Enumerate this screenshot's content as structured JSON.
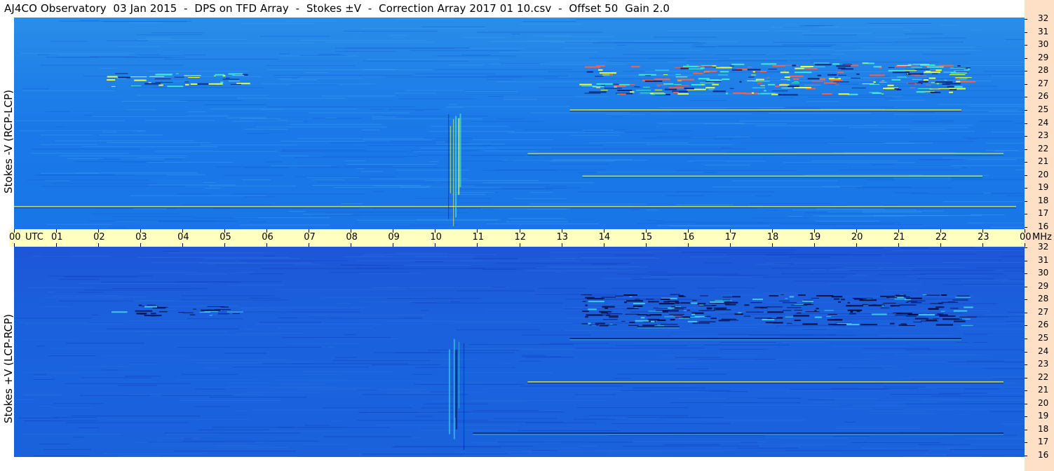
{
  "title": "AJ4CO Observatory  03 Jan 2015  -  DPS on TFD Array  -  Stokes ±V  -  Correction Array 2017 01 10.csv  -  Offset 50  Gain 2.0",
  "colors": {
    "background_top": "#1f80e8",
    "background_bottom": "#1a5fdc",
    "time_bar": "#ffffc0",
    "freq_strip": "#fde0c6",
    "signal_high": "#e8ff40",
    "signal_low": "#0a1a60"
  },
  "chart_data": [
    {
      "type": "heatmap",
      "panel": "top",
      "ylabel": "Stokes -V (RCP-LCP)",
      "x_unit": "UTC",
      "x_ticks": [
        "00",
        "01",
        "02",
        "03",
        "04",
        "05",
        "06",
        "07",
        "08",
        "09",
        "10",
        "11",
        "12",
        "13",
        "14",
        "15",
        "16",
        "17",
        "18",
        "19",
        "20",
        "21",
        "22",
        "23",
        "00"
      ],
      "y_unit": "MHz",
      "y_ticks": [
        "32",
        "31",
        "30",
        "29",
        "28",
        "27",
        "26",
        "25",
        "24",
        "23",
        "22",
        "21",
        "20",
        "19",
        "18",
        "17",
        "16"
      ],
      "xlim": [
        0,
        24
      ],
      "ylim": [
        16,
        32
      ],
      "features": [
        {
          "kind": "band",
          "x": [
            2.2,
            5.3
          ],
          "y": [
            26.8,
            27.8
          ],
          "intensity": "mixed"
        },
        {
          "kind": "band",
          "x": [
            13.4,
            22.6
          ],
          "y": [
            26.2,
            28.6
          ],
          "intensity": "high"
        },
        {
          "kind": "line",
          "x": [
            0.0,
            23.8
          ],
          "y": [
            17.7,
            17.7
          ],
          "intensity": "high"
        },
        {
          "kind": "line",
          "x": [
            12.2,
            23.5
          ],
          "y": [
            21.7,
            21.7
          ],
          "intensity": "high"
        },
        {
          "kind": "line",
          "x": [
            13.5,
            23.0
          ],
          "y": [
            20.0,
            20.0
          ],
          "intensity": "high"
        },
        {
          "kind": "line",
          "x": [
            13.2,
            22.5
          ],
          "y": [
            25.0,
            25.0
          ],
          "intensity": "high"
        },
        {
          "kind": "burst",
          "x": [
            10.3,
            10.6
          ],
          "y": [
            16.0,
            24.8
          ],
          "intensity": "medium"
        }
      ]
    },
    {
      "type": "heatmap",
      "panel": "bottom",
      "ylabel": "Stokes +V (LCP-RCP)",
      "x_unit": "UTC",
      "x_ticks": [
        "00",
        "01",
        "02",
        "03",
        "04",
        "05",
        "06",
        "07",
        "08",
        "09",
        "10",
        "11",
        "12",
        "13",
        "14",
        "15",
        "16",
        "17",
        "18",
        "19",
        "20",
        "21",
        "22",
        "23",
        "00"
      ],
      "y_unit": "MHz",
      "y_ticks": [
        "32",
        "31",
        "30",
        "29",
        "28",
        "27",
        "26",
        "25",
        "24",
        "23",
        "22",
        "21",
        "20",
        "19",
        "18",
        "17",
        "16"
      ],
      "xlim": [
        0,
        24
      ],
      "ylim": [
        16,
        32
      ],
      "features": [
        {
          "kind": "band",
          "x": [
            2.2,
            5.3
          ],
          "y": [
            26.8,
            27.6
          ],
          "intensity": "low"
        },
        {
          "kind": "band",
          "x": [
            13.4,
            22.6
          ],
          "y": [
            26.0,
            28.4
          ],
          "intensity": "low"
        },
        {
          "kind": "line",
          "x": [
            14.8,
            15.8
          ],
          "y": [
            25.9,
            25.9
          ],
          "intensity": "low"
        },
        {
          "kind": "line",
          "x": [
            10.9,
            23.5
          ],
          "y": [
            17.8,
            17.8
          ],
          "intensity": "low"
        },
        {
          "kind": "line",
          "x": [
            12.2,
            23.5
          ],
          "y": [
            21.7,
            21.7
          ],
          "intensity": "high"
        },
        {
          "kind": "line",
          "x": [
            13.2,
            22.5
          ],
          "y": [
            25.0,
            25.0
          ],
          "intensity": "low"
        },
        {
          "kind": "burst",
          "x": [
            10.3,
            10.7
          ],
          "y": [
            16.0,
            25.0
          ],
          "intensity": "low"
        }
      ]
    }
  ]
}
